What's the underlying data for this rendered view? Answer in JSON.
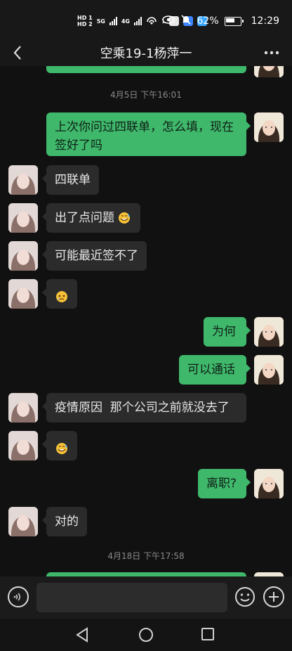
{
  "status_bar": {
    "hd1": "HD 1",
    "hd2": "HD 2",
    "net1": "5G",
    "net2": "4G",
    "wifi_badge": "1",
    "battery": "62%",
    "time": "12:29"
  },
  "nav": {
    "title": "空乘19-1杨萍一",
    "back_icon": "chevron-left-icon",
    "more_icon": "more-dots-icon"
  },
  "chat": {
    "date_labels": [
      "4月5日 下午16:01",
      "4月18日 下午17:58"
    ],
    "messages": [
      {
        "side": "right",
        "text": "上次你问过四联单，怎么填，现在签好了吗"
      },
      {
        "side": "left",
        "text": "四联单"
      },
      {
        "side": "left",
        "text": "出了点问题",
        "emoji": "grin-sweat"
      },
      {
        "side": "left",
        "text": "可能最近签不了"
      },
      {
        "side": "left",
        "text": "",
        "emoji": "teary-face"
      },
      {
        "side": "right",
        "text": "为何"
      },
      {
        "side": "right",
        "text": "可以通话"
      },
      {
        "side": "left",
        "text": "疫情原因  那个公司之前就没去了"
      },
      {
        "side": "left",
        "text": "",
        "emoji": "grin-sweat"
      },
      {
        "side": "right",
        "text": "离职?"
      },
      {
        "side": "left",
        "text": "对的"
      }
    ]
  },
  "input_bar": {
    "voice_icon": "voice-icon",
    "placeholder": "",
    "emoji_icon": "emoji-icon",
    "plus_icon": "plus-icon"
  },
  "system_nav": {
    "back": "triangle-back-icon",
    "home": "circle-home-icon",
    "recent": "square-recent-icon"
  },
  "colors": {
    "background": "#111111",
    "bubble_incoming": "#2b2b2b",
    "bubble_outgoing": "#3fb86c"
  }
}
